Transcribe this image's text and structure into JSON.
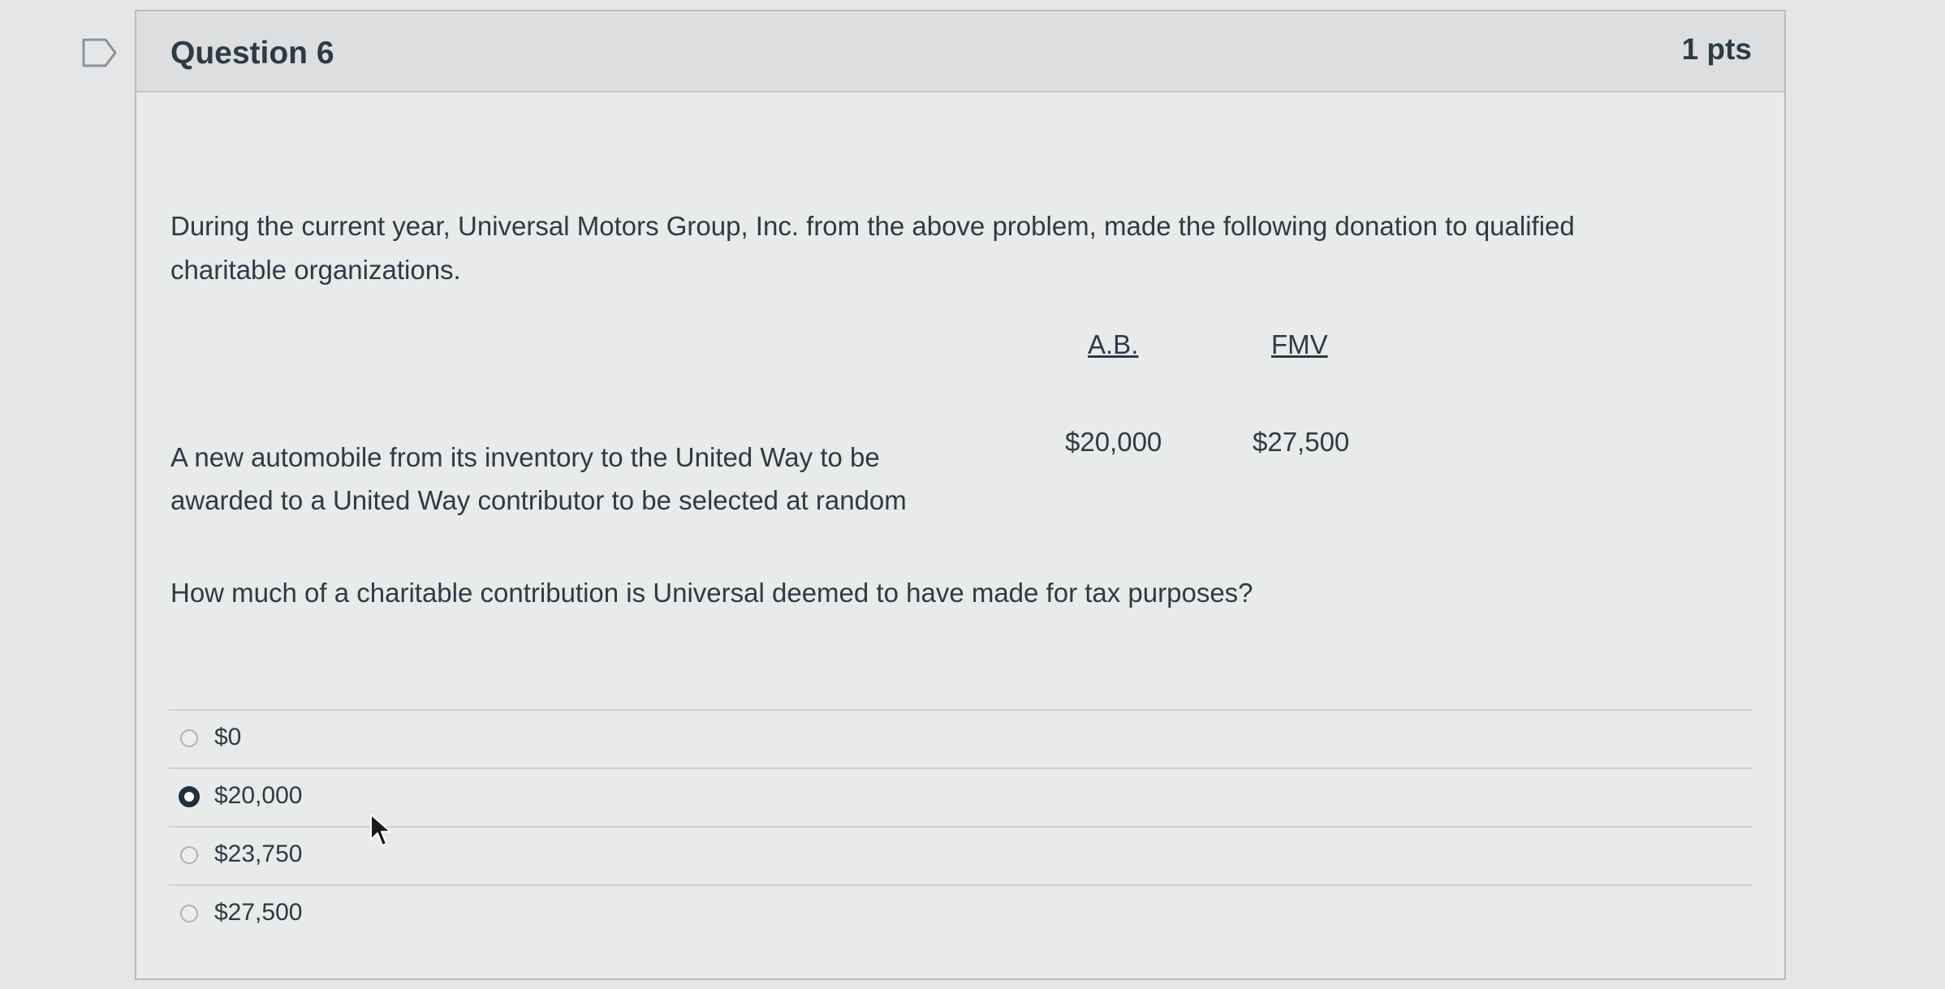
{
  "question": {
    "title": "Question 6",
    "points": "1 pts",
    "text": "During the current year, Universal Motors Group, Inc. from the above problem, made the following donation to qualified charitable organizations.",
    "table": {
      "col_ab": "A.B.",
      "col_fmv": "FMV",
      "item_description": "A new automobile from its inventory to the United Way to be awarded to a United Way contributor to be selected at random",
      "item_ab": "$20,000",
      "item_fmv": "$27,500"
    },
    "prompt": "How much of a charitable contribution is Universal deemed to have made for tax purposes?"
  },
  "answers": [
    {
      "label": "$0",
      "selected": false
    },
    {
      "label": "$20,000",
      "selected": true
    },
    {
      "label": "$23,750",
      "selected": false
    },
    {
      "label": "$27,500",
      "selected": false
    }
  ],
  "icons": {
    "bookmark": "bookmark-flag-icon",
    "cursor": "mouse-pointer-icon"
  },
  "colors": {
    "selected_radio": "#1f2f3d",
    "text": "#2d3b45"
  }
}
